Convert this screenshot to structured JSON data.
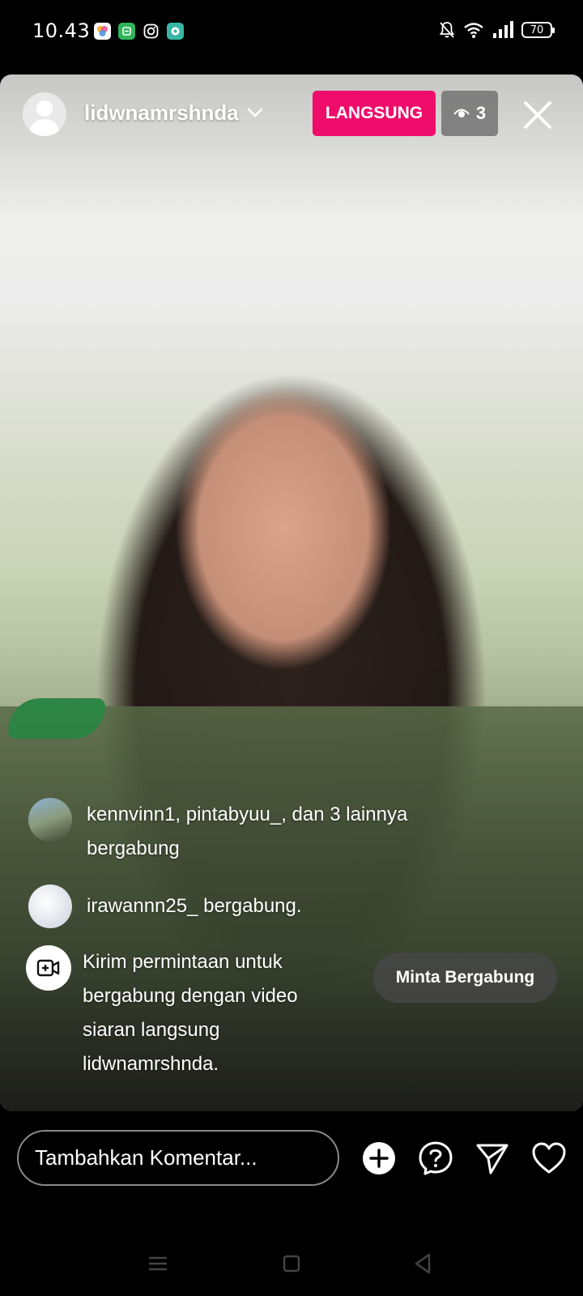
{
  "status_bar": {
    "time": "10.43",
    "battery": "70",
    "notification_icons": [
      "photos-app-icon",
      "green-app-icon",
      "instagram-icon",
      "messaging-app-icon"
    ],
    "system_icons": [
      "mute-bell-icon",
      "wifi-icon",
      "signal-icon",
      "battery-icon"
    ]
  },
  "live_header": {
    "username": "lidwnamrshnda",
    "live_label": "LANGSUNG",
    "viewer_count": "3",
    "live_badge_color": "#ee0d6a"
  },
  "feed": {
    "join_summary": "kennvinn1, pintabyuu_, dan 3 lainnya bergabung",
    "join_single": "irawannn25_ bergabung.",
    "request_text": "Kirim permintaan untuk bergabung dengan video siaran langsung lidwnamrshnda.",
    "request_button": "Minta Bergabung"
  },
  "bottom_bar": {
    "comment_placeholder": "Tambahkan Komentar...",
    "actions": [
      "add-icon",
      "question-icon",
      "send-icon",
      "heart-icon"
    ]
  },
  "nav_bar": [
    "menu-icon",
    "home-icon",
    "back-icon"
  ]
}
